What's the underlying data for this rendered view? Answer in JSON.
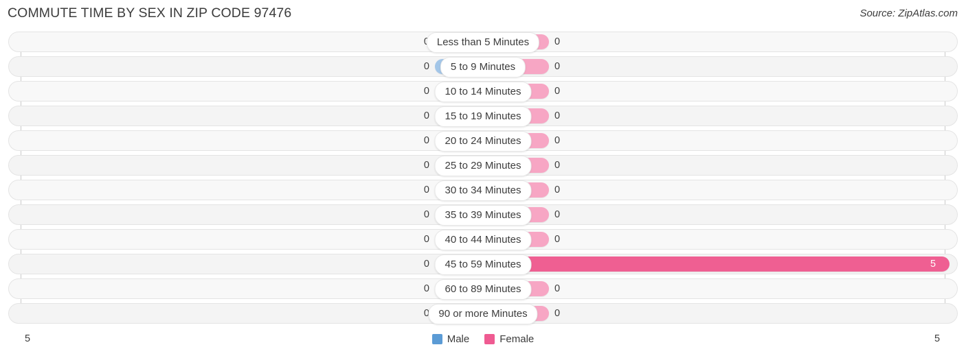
{
  "header": {
    "title": "COMMUTE TIME BY SEX IN ZIP CODE 97476",
    "source": "Source: ZipAtlas.com"
  },
  "axis": {
    "left_label": "5",
    "right_label": "5"
  },
  "legend": {
    "male_label": "Male",
    "female_label": "Female",
    "male_color": "#5b9bd5",
    "female_color": "#ef5b92"
  },
  "colors": {
    "bar_male": "#a3c6e8",
    "bar_female": "#f7a6c4",
    "bar_female_highlight": "#ef5f92",
    "track": "#f7f7f7",
    "text": "#3c3c3c"
  },
  "chart_data": {
    "type": "bar",
    "title": "COMMUTE TIME BY SEX IN ZIP CODE 97476",
    "subtitle": "Source: ZipAtlas.com",
    "orientation": "horizontal-diverging",
    "xlabel": "",
    "ylabel": "",
    "xlim": [
      5,
      5
    ],
    "grid": true,
    "legend_position": "bottom-center",
    "categories": [
      "Less than 5 Minutes",
      "5 to 9 Minutes",
      "10 to 14 Minutes",
      "15 to 19 Minutes",
      "20 to 24 Minutes",
      "25 to 29 Minutes",
      "30 to 34 Minutes",
      "35 to 39 Minutes",
      "40 to 44 Minutes",
      "45 to 59 Minutes",
      "60 to 89 Minutes",
      "90 or more Minutes"
    ],
    "series": [
      {
        "name": "Male",
        "values": [
          0,
          0,
          0,
          0,
          0,
          0,
          0,
          0,
          0,
          0,
          0,
          0
        ]
      },
      {
        "name": "Female",
        "values": [
          0,
          0,
          0,
          0,
          0,
          0,
          0,
          0,
          0,
          5,
          0,
          0
        ]
      }
    ]
  },
  "rows": [
    {
      "label": "Less than 5 Minutes",
      "male": "0",
      "female": "0",
      "male_w": 70,
      "female_w": 96,
      "female_inside": false
    },
    {
      "label": "5 to 9 Minutes",
      "male": "0",
      "female": "0",
      "male_w": 70,
      "female_w": 96,
      "female_inside": false
    },
    {
      "label": "10 to 14 Minutes",
      "male": "0",
      "female": "0",
      "male_w": 70,
      "female_w": 96,
      "female_inside": false
    },
    {
      "label": "15 to 19 Minutes",
      "male": "0",
      "female": "0",
      "male_w": 70,
      "female_w": 96,
      "female_inside": false
    },
    {
      "label": "20 to 24 Minutes",
      "male": "0",
      "female": "0",
      "male_w": 70,
      "female_w": 96,
      "female_inside": false
    },
    {
      "label": "25 to 29 Minutes",
      "male": "0",
      "female": "0",
      "male_w": 70,
      "female_w": 96,
      "female_inside": false
    },
    {
      "label": "30 to 34 Minutes",
      "male": "0",
      "female": "0",
      "male_w": 70,
      "female_w": 96,
      "female_inside": false
    },
    {
      "label": "35 to 39 Minutes",
      "male": "0",
      "female": "0",
      "male_w": 70,
      "female_w": 96,
      "female_inside": false
    },
    {
      "label": "40 to 44 Minutes",
      "male": "0",
      "female": "0",
      "male_w": 70,
      "female_w": 96,
      "female_inside": false
    },
    {
      "label": "45 to 59 Minutes",
      "male": "0",
      "female": "5",
      "male_w": 70,
      "female_w": 679,
      "female_inside": true
    },
    {
      "label": "60 to 89 Minutes",
      "male": "0",
      "female": "0",
      "male_w": 70,
      "female_w": 96,
      "female_inside": false
    },
    {
      "label": "90 or more Minutes",
      "male": "0",
      "female": "0",
      "male_w": 70,
      "female_w": 96,
      "female_inside": false
    }
  ]
}
